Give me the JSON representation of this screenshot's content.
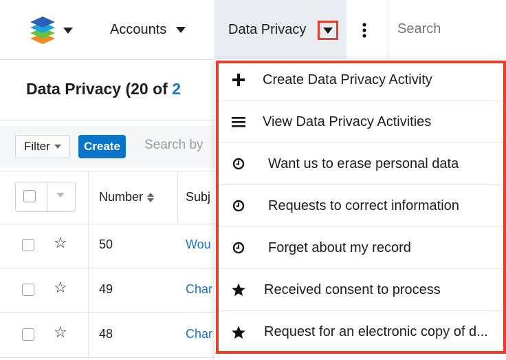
{
  "nav": {
    "modules": [
      {
        "label": "Accounts"
      },
      {
        "label": "Data Privacy"
      }
    ],
    "search_placeholder": "Search"
  },
  "page": {
    "title_prefix": "Data Privacy (20 of ",
    "title_count": "2"
  },
  "toolbar": {
    "filter_label": "Filter",
    "create_label": "Create",
    "search_placeholder": "Search by"
  },
  "table": {
    "columns": [
      "Number",
      "Subj"
    ],
    "rows": [
      {
        "number": "50",
        "subject": "Wou"
      },
      {
        "number": "49",
        "subject": "Char"
      },
      {
        "number": "48",
        "subject": "Char"
      }
    ]
  },
  "menu": {
    "items": [
      {
        "label": "Create Data Privacy Activity",
        "icon": "plus-icon"
      },
      {
        "label": "View Data Privacy Activities",
        "icon": "list-icon"
      },
      {
        "label": "Want us to erase personal data",
        "icon": "clock-icon"
      },
      {
        "label": "Requests to correct information",
        "icon": "clock-icon"
      },
      {
        "label": "Forget about my record",
        "icon": "clock-icon"
      },
      {
        "label": "Received consent to process",
        "icon": "star-icon"
      },
      {
        "label": "Request for an electronic copy of d...",
        "icon": "star-icon"
      }
    ]
  },
  "colors": {
    "highlight": "#e2402a",
    "link": "#1a73c4",
    "primary_button": "#0a74c9",
    "active_tab_bg": "#e9edf1"
  }
}
